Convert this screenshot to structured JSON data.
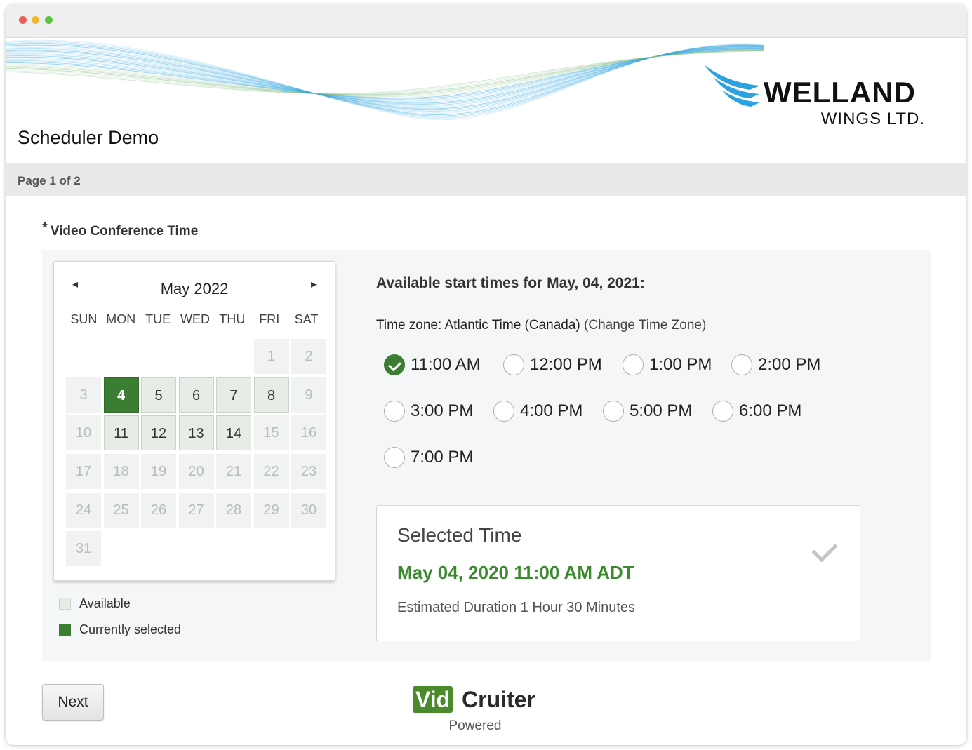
{
  "header": {
    "page_title": "Scheduler Demo",
    "logo_main": "WELLAND",
    "logo_sub": "WINGS LTD.",
    "accent_color": "#2aa3e0"
  },
  "pagebar": {
    "label": "Page 1 of 2"
  },
  "field": {
    "required_mark": "*",
    "label": "Video Conference Time"
  },
  "calendar": {
    "prev_icon": "◂",
    "next_icon": "▸",
    "month_label": "May 2022",
    "days_of_week": [
      "SUN",
      "MON",
      "TUE",
      "WED",
      "THU",
      "FRI",
      "SAT"
    ],
    "first_weekday": 0,
    "leading_blank": 5,
    "days": [
      {
        "day": "1",
        "state": "disabled"
      },
      {
        "day": "2",
        "state": "disabled"
      },
      {
        "day": "3",
        "state": "disabled"
      },
      {
        "day": "4",
        "state": "selected"
      },
      {
        "day": "5",
        "state": "available"
      },
      {
        "day": "6",
        "state": "available"
      },
      {
        "day": "7",
        "state": "available"
      },
      {
        "day": "8",
        "state": "available"
      },
      {
        "day": "9",
        "state": "disabled"
      },
      {
        "day": "10",
        "state": "disabled"
      },
      {
        "day": "11",
        "state": "available"
      },
      {
        "day": "12",
        "state": "available"
      },
      {
        "day": "13",
        "state": "available"
      },
      {
        "day": "14",
        "state": "available"
      },
      {
        "day": "15",
        "state": "disabled"
      },
      {
        "day": "16",
        "state": "disabled"
      },
      {
        "day": "17",
        "state": "disabled"
      },
      {
        "day": "18",
        "state": "disabled"
      },
      {
        "day": "19",
        "state": "disabled"
      },
      {
        "day": "20",
        "state": "disabled"
      },
      {
        "day": "21",
        "state": "disabled"
      },
      {
        "day": "22",
        "state": "disabled"
      },
      {
        "day": "23",
        "state": "disabled"
      },
      {
        "day": "24",
        "state": "disabled"
      },
      {
        "day": "25",
        "state": "disabled"
      },
      {
        "day": "26",
        "state": "disabled"
      },
      {
        "day": "27",
        "state": "disabled"
      },
      {
        "day": "28",
        "state": "disabled"
      },
      {
        "day": "29",
        "state": "disabled"
      },
      {
        "day": "30",
        "state": "disabled"
      },
      {
        "day": "31",
        "state": "disabled"
      }
    ],
    "selected_color": "#3b7d33",
    "available_color": "#e6ede6"
  },
  "legend": {
    "available": "Available",
    "selected": "Currently selected"
  },
  "times": {
    "title": "Available start times for May, 04, 2021:",
    "timezone_prefix": "Time zone: Atlantic Time (Canada) ",
    "timezone_link": "(Change Time Zone)",
    "slots": [
      {
        "label": "11:00 AM",
        "checked": true
      },
      {
        "label": "12:00 PM",
        "checked": false
      },
      {
        "label": "1:00 PM",
        "checked": false
      },
      {
        "label": "2:00 PM",
        "checked": false
      },
      {
        "label": "3:00 PM",
        "checked": false
      },
      {
        "label": "4:00 PM",
        "checked": false
      },
      {
        "label": "5:00 PM",
        "checked": false
      },
      {
        "label": "6:00 PM",
        "checked": false
      },
      {
        "label": "7:00 PM",
        "checked": false
      }
    ]
  },
  "selected_time": {
    "title": "Selected Time",
    "value": "May 04, 2020 11:00 AM ADT",
    "duration": "Estimated Duration 1 Hour 30 Minutes",
    "value_color": "#3b8a2e"
  },
  "footer": {
    "next_label": "Next",
    "brand_vid": "Vid",
    "brand_cruiter": "Cruiter",
    "powered": "Powered"
  }
}
